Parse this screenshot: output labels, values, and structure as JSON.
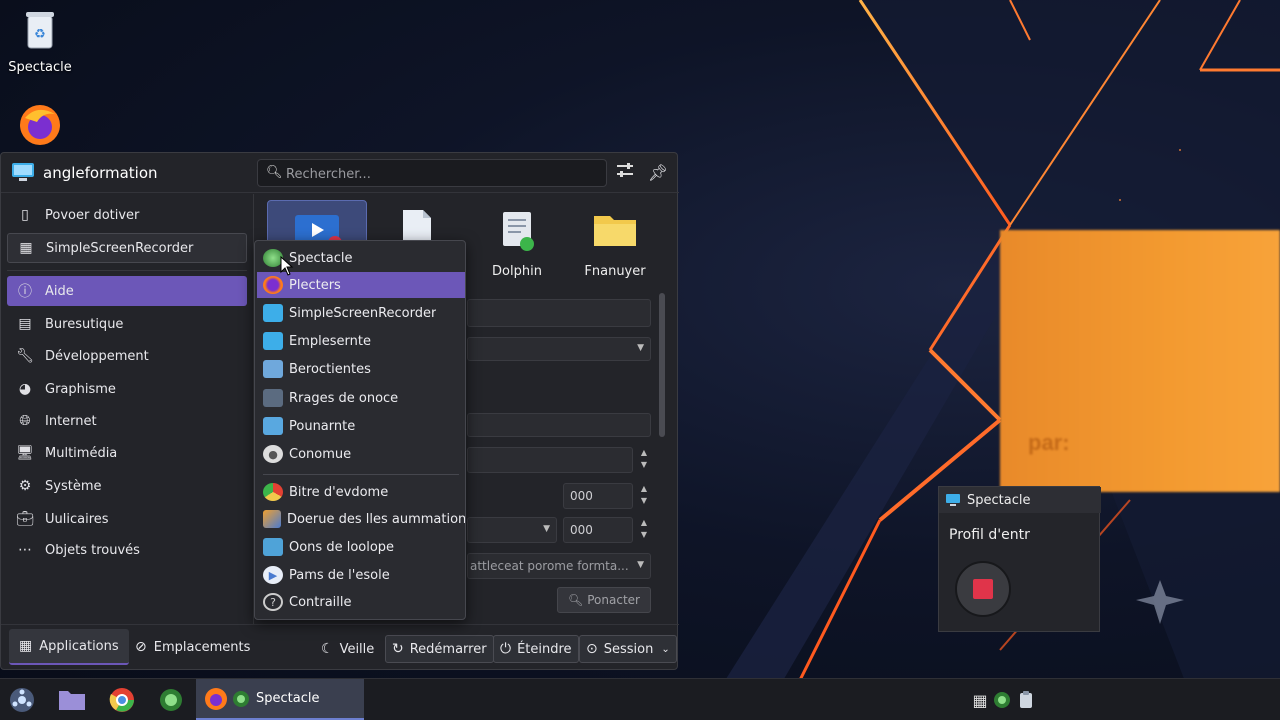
{
  "desktop": {
    "icons": [
      {
        "label": "Spectacle",
        "icon": "trash-icon"
      },
      {
        "label": "",
        "icon": "firefox-icon"
      }
    ],
    "overlay_text": "par:"
  },
  "launcher": {
    "user_name": "angleformation",
    "search_placeholder": "Rechercher...",
    "sidebar": [
      {
        "label": "Povoer dotiver",
        "icon": "tablet-icon"
      },
      {
        "label": "SimpleScreenRecorder",
        "icon": "grid-icon"
      },
      {
        "label": "Aide",
        "icon": "help-icon"
      },
      {
        "label": "Buresutique",
        "icon": "office-icon"
      },
      {
        "label": "Développement",
        "icon": "wrench-icon"
      },
      {
        "label": "Graphisme",
        "icon": "palette-icon"
      },
      {
        "label": "Internet",
        "icon": "globe-icon"
      },
      {
        "label": "Multimédia",
        "icon": "monitor-icon"
      },
      {
        "label": "Système",
        "icon": "gear-icon"
      },
      {
        "label": "Uulicaires",
        "icon": "briefcase-icon"
      },
      {
        "label": "Objets trouvés",
        "icon": "dots-icon"
      }
    ],
    "apps": [
      {
        "label": ""
      },
      {
        "label": ""
      },
      {
        "label": "Dolphin"
      },
      {
        "label": "Fnanuyer"
      }
    ],
    "panel": {
      "value1": "000",
      "value2": "000",
      "combo_text": "attleceat porome formta...",
      "search_btn": "Ponacter"
    },
    "bottom": {
      "tabs": [
        {
          "label": "Applications",
          "icon": "apps-icon"
        },
        {
          "label": "Emplacements",
          "icon": "compass-icon"
        }
      ],
      "power": [
        {
          "label": "Veille",
          "icon": "sleep-icon"
        },
        {
          "label": "Redémarrer",
          "icon": "restart-icon"
        },
        {
          "label": "Éteindre",
          "icon": "power-icon"
        },
        {
          "label": "Session",
          "icon": "session-icon"
        }
      ]
    }
  },
  "popup_menu": {
    "items": [
      {
        "label": "Spectacle",
        "icon": "spectacle-icon",
        "color": "#4caf50"
      },
      {
        "label": "Plecters",
        "icon": "firefox-icon",
        "color": "#e66000"
      },
      {
        "label": "SimpleScreenRecorder",
        "icon": "folder-icon",
        "color": "#3daee9"
      },
      {
        "label": "Emplesernte",
        "icon": "folder-icon",
        "color": "#3daee9"
      },
      {
        "label": "Beroctientes",
        "icon": "folder-icon",
        "color": "#6fa8dc"
      },
      {
        "label": "Rrages de onoce",
        "icon": "folder-icon",
        "color": "#5b6b80"
      },
      {
        "label": "Pounarnte",
        "icon": "folder-icon",
        "color": "#59a8e0"
      },
      {
        "label": "Conomue",
        "icon": "disc-icon",
        "color": "#dddddd"
      },
      {
        "label": "Bitre d'evdome",
        "icon": "chrome-icon",
        "color": "#e34133"
      },
      {
        "label": "Doerue des lles aummations...",
        "icon": "image-icon",
        "color": "#f0a030"
      },
      {
        "label": "Oons de loolope",
        "icon": "folder-icon",
        "color": "#4fa3d8"
      },
      {
        "label": "Pams de l'esole",
        "icon": "play-icon",
        "color": "#4a7bd0"
      },
      {
        "label": "Contraille",
        "icon": "help-icon",
        "color": "#cccccc"
      }
    ]
  },
  "spectacle_window": {
    "title": "Spectacle",
    "profile_label": "Profil d'entr"
  },
  "taskbar": {
    "task_label": "Spectacle"
  }
}
